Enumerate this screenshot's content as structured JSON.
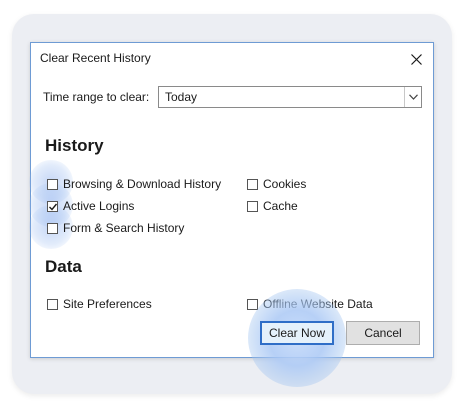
{
  "dialog": {
    "title": "Clear Recent History",
    "close_icon": "close-icon"
  },
  "time_range": {
    "label": "Time range to clear:",
    "selected": "Today"
  },
  "history": {
    "heading": "History",
    "items": [
      {
        "label": "Browsing & Download History",
        "checked": false
      },
      {
        "label": "Cookies",
        "checked": false
      },
      {
        "label": "Active Logins",
        "checked": true
      },
      {
        "label": "Cache",
        "checked": false
      },
      {
        "label": "Form & Search History",
        "checked": false
      }
    ]
  },
  "data_section": {
    "heading": "Data",
    "items": [
      {
        "label": "Site Preferences",
        "checked": false
      },
      {
        "label": "Offline Website Data",
        "checked": false
      }
    ]
  },
  "buttons": {
    "clear_now": "Clear Now",
    "cancel": "Cancel"
  },
  "colors": {
    "accent": "#2f6ec7",
    "highlight": "#8fb3ef"
  }
}
